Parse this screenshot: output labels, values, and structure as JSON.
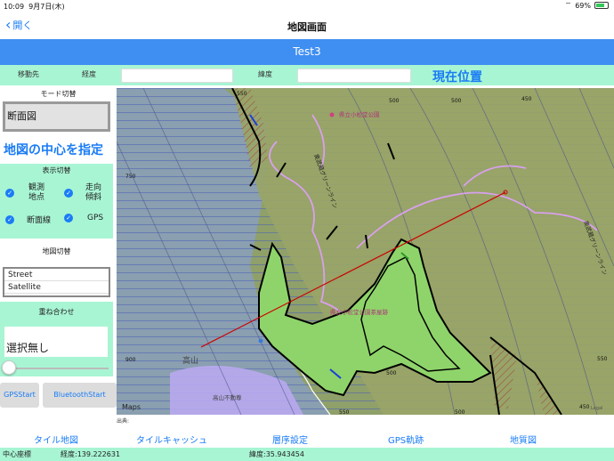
{
  "status_bar": {
    "time": "10:09",
    "date": "9月7日(木)",
    "battery": "69%"
  },
  "nav": {
    "back_label": "開く",
    "title": "地図画面"
  },
  "header": {
    "title": "Test3"
  },
  "coord_row": {
    "dest_label": "移動先",
    "lon_label": "経度",
    "lon_value": "",
    "lat_label": "緯度",
    "lat_value": "",
    "current_position": "現在位置"
  },
  "left_panel": {
    "mode_label": "モード切替",
    "mode_button": "断面図",
    "center_label": "地図の中心を指定",
    "display_label": "表示切替",
    "checks": [
      {
        "label": "観測\n地点"
      },
      {
        "label": "走向\n傾斜"
      },
      {
        "label": "断面線"
      },
      {
        "label": "GPS"
      }
    ],
    "map_switch_label": "地図切替",
    "map_options": [
      "Street",
      "Satellite"
    ],
    "overlay_label": "重ね合わせ",
    "overlay_value": "選択無し",
    "gps_start": "GPSStart",
    "bluetooth_start": "BluetoothStart"
  },
  "map": {
    "contour_labels": [
      "550",
      "500",
      "500",
      "450",
      "750",
      "900",
      "500",
      "550",
      "500",
      "550",
      "450"
    ],
    "place_labels": [
      "県立小松堂公園",
      "奥武蔵グリーンライン",
      "奥武蔵グリーンライン",
      "県立小松堂公園茶屋跡",
      "高山",
      "高山不動尊"
    ],
    "maps_logo": "Maps",
    "legal": "Legal"
  },
  "credit": "出典:",
  "tabs": [
    "タイル地図",
    "タイルキャッシュ",
    "層序設定",
    "GPS軌跡",
    "地質図"
  ],
  "footer": {
    "center_label": "中心座標",
    "lon_text": "経度:139.222631",
    "lat_text": "緯度:35.943454"
  },
  "colors": {
    "accent": "#1a7cf5",
    "header": "#3f8ef2",
    "mint": "#a8f5d4",
    "polygon": "#8fd46a"
  }
}
